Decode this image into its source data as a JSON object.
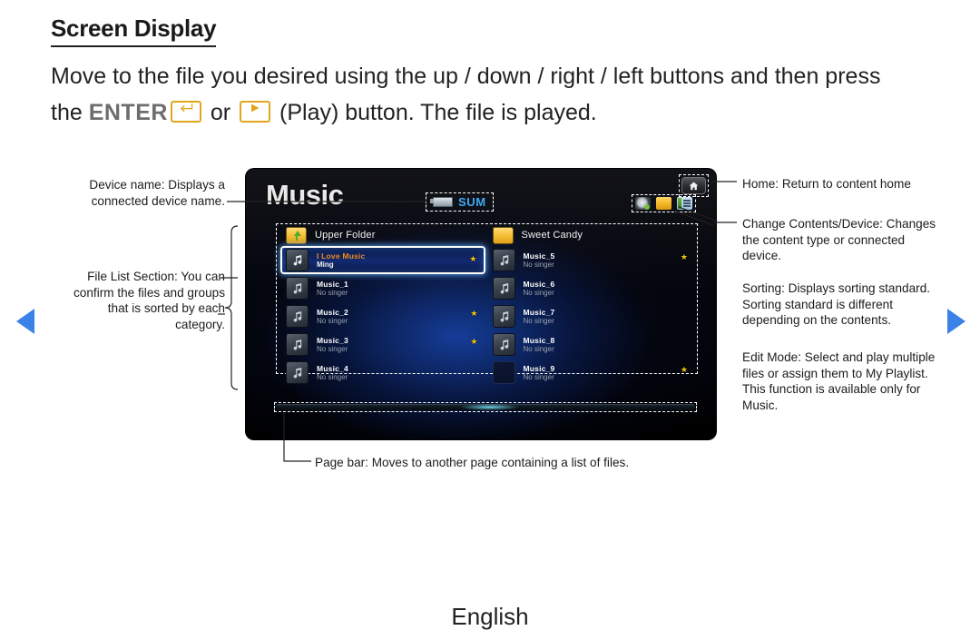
{
  "page": {
    "title": "Screen Display",
    "intro_part1": "Move to the file you desired using the up / down / right / left buttons and then press ",
    "intro_the": "the ",
    "intro_enter": "ENTER",
    "intro_or": " or ",
    "intro_part2": " (Play) button. The file is played.",
    "footer_language": "English"
  },
  "nav": {
    "prev_label": "previous-page",
    "next_label": "next-page"
  },
  "tv": {
    "title": "Music",
    "device_badge": "SUM",
    "icons": {
      "home": "home-icon",
      "sorting": "sorting-icon",
      "change_contents": "change-contents-device-icon",
      "edit_mode": "edit-mode-icon"
    },
    "columns": [
      {
        "folder": "Upper Folder",
        "folder_icon": "folder-up-icon",
        "items": [
          {
            "title": "I Love Music",
            "subtitle": "Ming",
            "starred": true,
            "selected": true,
            "icon": "music-note-icon"
          },
          {
            "title": "Music_1",
            "subtitle": "No singer",
            "starred": false,
            "selected": false,
            "icon": "music-note-icon"
          },
          {
            "title": "Music_2",
            "subtitle": "No singer",
            "starred": true,
            "selected": false,
            "icon": "music-note-icon"
          },
          {
            "title": "Music_3",
            "subtitle": "No singer",
            "starred": true,
            "selected": false,
            "icon": "music-note-icon"
          },
          {
            "title": "Music_4",
            "subtitle": "No singer",
            "starred": false,
            "selected": false,
            "icon": "music-note-icon"
          }
        ]
      },
      {
        "folder": "Sweet Candy",
        "folder_icon": "folder-icon",
        "items": [
          {
            "title": "Music_5",
            "subtitle": "No singer",
            "starred": true,
            "selected": false,
            "icon": "music-note-icon"
          },
          {
            "title": "Music_6",
            "subtitle": "No singer",
            "starred": false,
            "selected": false,
            "icon": "music-note-icon"
          },
          {
            "title": "Music_7",
            "subtitle": "No singer",
            "starred": false,
            "selected": false,
            "icon": "music-note-icon"
          },
          {
            "title": "Music_8",
            "subtitle": "No singer",
            "starred": false,
            "selected": false,
            "icon": "music-note-icon"
          },
          {
            "title": "Music_9",
            "subtitle": "No singer",
            "starred": true,
            "selected": false,
            "icon": "blank-icon"
          }
        ]
      }
    ],
    "page_bar": "page-bar"
  },
  "callouts": {
    "device_name": "Device name: Displays a connected device name.",
    "file_list": "File List Section: You can confirm the files and groups that is sorted by each category.",
    "home": "Home: Return to content home",
    "change_contents": "Change Contents/Device: Changes the content type or connected device.",
    "sorting": "Sorting: Displays sorting standard. Sorting standard is different depending on the contents.",
    "edit_mode": "Edit Mode: Select and play multiple files or assign them to My Playlist. This function is available only for Music.",
    "page_bar": "Page bar: Moves to another page containing a list of files."
  },
  "colors": {
    "accent_blue": "#3b82e8",
    "key_border": "#e2a61c",
    "star": "#f2c10e",
    "selected_title": "#f08c1e",
    "device_badge": "#3fa9f5"
  }
}
